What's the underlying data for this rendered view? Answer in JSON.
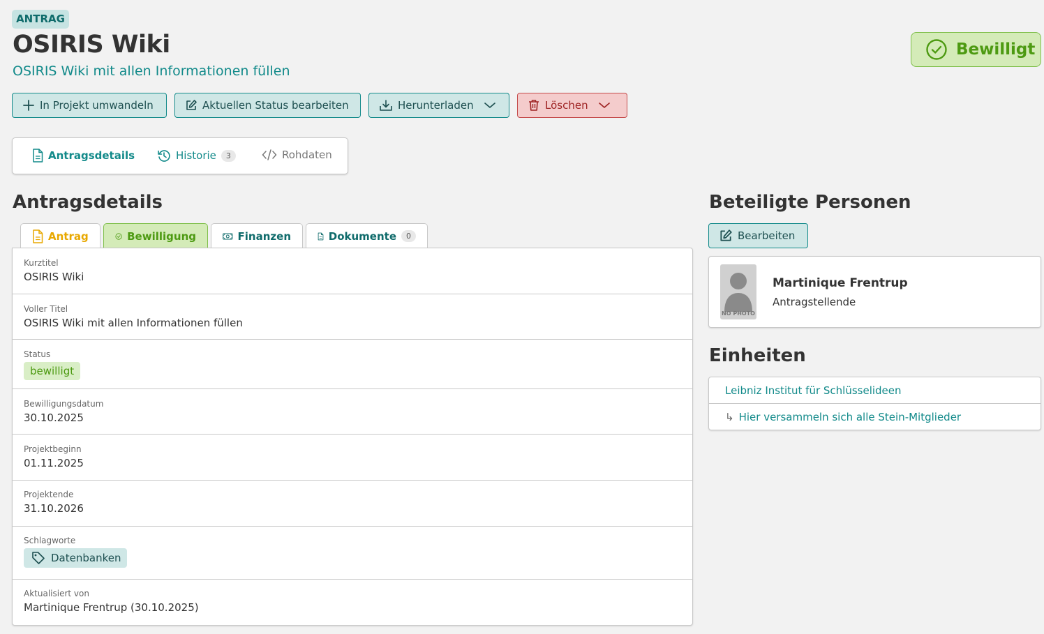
{
  "header": {
    "type_badge": "ANTRAG",
    "title": "OSIRIS Wiki",
    "subtitle": "OSIRIS Wiki mit allen Informationen füllen",
    "status": "Bewilligt"
  },
  "actions": {
    "convert": "In Projekt umwandeln",
    "edit_status": "Aktuellen Status bearbeiten",
    "download": "Herunterladen",
    "delete": "Löschen"
  },
  "tabs": {
    "details": "Antragsdetails",
    "history": "Historie",
    "history_count": "3",
    "raw": "Rohdaten"
  },
  "details": {
    "heading": "Antragsdetails",
    "subtabs": {
      "antrag": "Antrag",
      "bewilligung": "Bewilligung",
      "finanzen": "Finanzen",
      "dokumente": "Dokumente",
      "dokumente_count": "0"
    },
    "fields": [
      {
        "label": "Kurztitel",
        "value": "OSIRIS Wiki"
      },
      {
        "label": "Voller Titel",
        "value": "OSIRIS Wiki mit allen Informationen füllen"
      },
      {
        "label": "Status",
        "value": "bewilligt"
      },
      {
        "label": "Bewilligungsdatum",
        "value": "30.10.2025"
      },
      {
        "label": "Projektbeginn",
        "value": "01.11.2025"
      },
      {
        "label": "Projektende",
        "value": "31.10.2026"
      },
      {
        "label": "Schlagworte",
        "value": "Datenbanken"
      },
      {
        "label": "Aktualisiert von",
        "value": "Martinique Frentrup (30.10.2025)"
      }
    ]
  },
  "persons": {
    "heading": "Beteiligte Personen",
    "edit_label": "Bearbeiten",
    "items": [
      {
        "name": "Martinique Frentrup",
        "role": "Antragstellende",
        "photo_placeholder": "NO PHOTO"
      }
    ]
  },
  "units": {
    "heading": "Einheiten",
    "items": [
      {
        "label": "Leibniz Institut für Schlüsselideen"
      },
      {
        "label": "Hier versammeln sich alle Stein-Mitglieder",
        "prefix": "↳"
      }
    ]
  },
  "colors": {
    "teal": "#128a8a",
    "green": "#4d9a12",
    "red": "#c44a4a",
    "yellow": "#e8a800"
  }
}
